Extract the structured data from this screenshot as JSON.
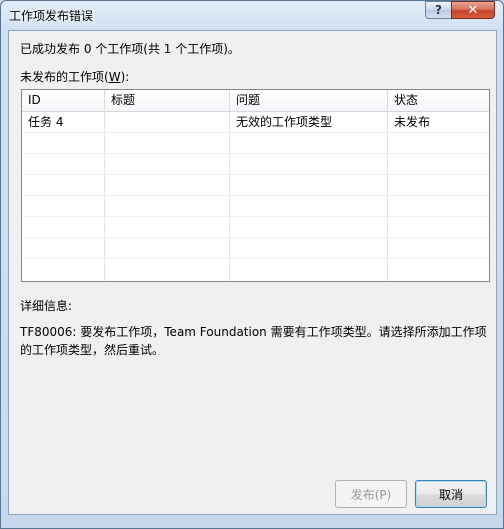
{
  "window": {
    "title": "工作项发布错误",
    "help_glyph": "?",
    "close_glyph": "✕"
  },
  "summary": "已成功发布 0 个工作项(共 1 个工作项)。",
  "unpublished": {
    "label_prefix": "未发布的工作项(",
    "label_key": "W",
    "label_suffix": "):",
    "columns": [
      "ID",
      "标题",
      "问题",
      "状态"
    ],
    "rows": [
      {
        "id": "任务 4",
        "title": "",
        "issue": "无效的工作项类型",
        "status": "未发布"
      }
    ]
  },
  "details": {
    "label": "详细信息:",
    "text": "TF80006: 要发布工作项，Team Foundation 需要有工作项类型。请选择所添加工作项的工作项类型，然后重试。"
  },
  "buttons": {
    "publish": "发布(P)",
    "cancel": "取消"
  }
}
